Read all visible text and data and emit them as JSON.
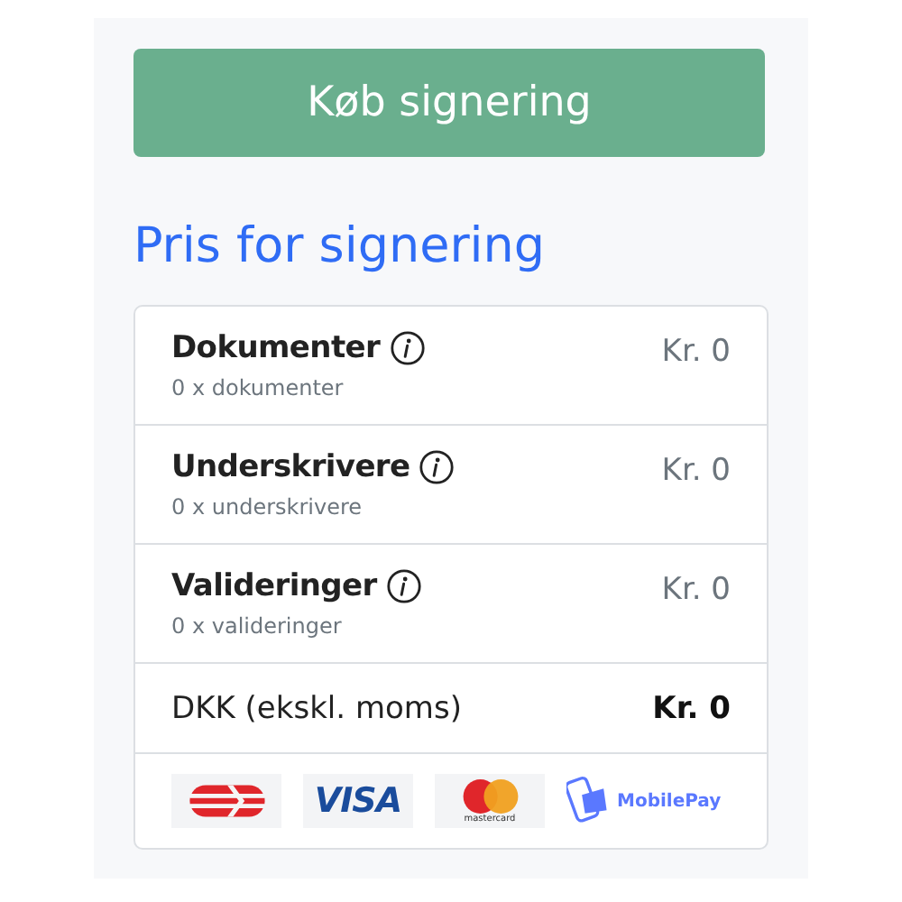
{
  "buy_button": {
    "label": "Køb signering"
  },
  "heading": "Pris for signering",
  "price_items": [
    {
      "title": "Dokumenter",
      "detail": "0 x dokumenter",
      "price": "Kr. 0"
    },
    {
      "title": "Underskrivere",
      "detail": "0 x underskrivere",
      "price": "Kr. 0"
    },
    {
      "title": "Valideringer",
      "detail": "0 x valideringer",
      "price": "Kr. 0"
    }
  ],
  "total": {
    "label": "DKK (ekskl. moms)",
    "price": "Kr. 0"
  },
  "payment_methods": [
    {
      "kind": "dankort"
    },
    {
      "kind": "visa",
      "text": "VISA"
    },
    {
      "kind": "mastercard",
      "text": "mastercard"
    },
    {
      "kind": "mobilepay",
      "text": "MobilePay"
    }
  ]
}
